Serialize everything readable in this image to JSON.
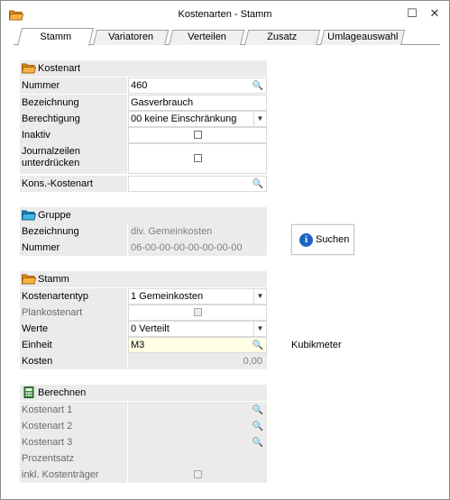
{
  "window": {
    "title": "Kostenarten - Stamm",
    "minimize_glyph": "☐",
    "close_glyph": "✕"
  },
  "tabs": [
    {
      "label": "Stamm"
    },
    {
      "label": "Variatoren"
    },
    {
      "label": "Verteilen"
    },
    {
      "label": "Zusatz"
    },
    {
      "label": "Umlageauswahl"
    }
  ],
  "kostenart": {
    "header": "Kostenart",
    "nummer_label": "Nummer",
    "nummer_value": "460",
    "bezeichnung_label": "Bezeichnung",
    "bezeichnung_value": "Gasverbrauch",
    "berechtigung_label": "Berechtigung",
    "berechtigung_value": "00 keine Einschränkung",
    "inaktiv_label": "Inaktiv",
    "journal_label_1": "Journalzeilen",
    "journal_label_2": "unterdrücken",
    "kons_label": "Kons.-Kostenart",
    "kons_value": ""
  },
  "gruppe": {
    "header": "Gruppe",
    "bezeichnung_label": "Bezeichnung",
    "bezeichnung_value": "div. Gemeinkosten",
    "nummer_label": "Nummer",
    "nummer_value": "06-00-00-00-00-00-00-00",
    "search_button": "Suchen"
  },
  "stamm": {
    "header": "Stamm",
    "typ_label": "Kostenartentyp",
    "typ_value": "1  Gemeinkosten",
    "plan_label": "Plankostenart",
    "werte_label": "Werte",
    "werte_value": "0  Verteilt",
    "einheit_label": "Einheit",
    "einheit_value": "M3",
    "einheit_desc": "Kubikmeter",
    "kosten_label": "Kosten",
    "kosten_value": "0,00"
  },
  "berechnen": {
    "header": "Berechnen",
    "k1_label": "Kostenart 1",
    "k2_label": "Kostenart 2",
    "k3_label": "Kostenart 3",
    "prozent_label": "Prozentsatz",
    "inkl_label": "inkl. Kostenträger"
  },
  "colors": {
    "folder_orange": "#f0a030",
    "folder_blue": "#2a9fd8",
    "info_blue": "#1b65c8",
    "label_bg": "#ebebeb"
  }
}
